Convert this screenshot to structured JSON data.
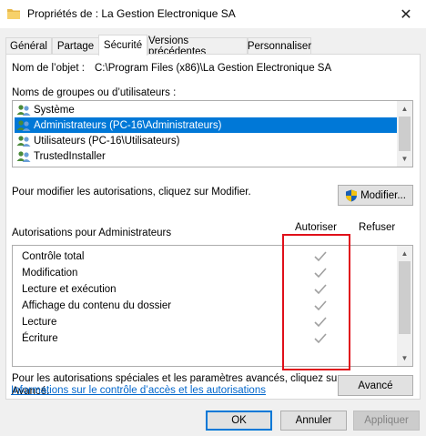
{
  "window": {
    "title": "Propriétés de : La Gestion Electronique SA",
    "close_glyph": "✕"
  },
  "tabs": [
    {
      "label": "Général"
    },
    {
      "label": "Partage"
    },
    {
      "label": "Sécurité"
    },
    {
      "label": "Versions précédentes"
    },
    {
      "label": "Personnaliser"
    }
  ],
  "security": {
    "object_name_label": "Nom de l’objet :",
    "object_name_value": "C:\\Program Files (x86)\\La Gestion Electronique SA",
    "groups_label": "Noms de groupes ou d’utilisateurs :",
    "groups": [
      {
        "label": "Système",
        "icon": "user-group-icon"
      },
      {
        "label": "Administrateurs (PC-16\\Administrateurs)",
        "icon": "user-group-icon",
        "selected": true
      },
      {
        "label": "Utilisateurs (PC-16\\Utilisateurs)",
        "icon": "user-group-icon"
      },
      {
        "label": "TrustedInstaller",
        "icon": "user-group-icon"
      }
    ],
    "modify_hint": "Pour modifier les autorisations, cliquez sur Modifier.",
    "modify_button": "Modifier...",
    "permissions_label": "Autorisations pour Administrateurs",
    "allow_header": "Autoriser",
    "deny_header": "Refuser",
    "permissions": [
      {
        "name": "Contrôle total",
        "allow": true,
        "deny": false
      },
      {
        "name": "Modification",
        "allow": true,
        "deny": false
      },
      {
        "name": "Lecture et exécution",
        "allow": true,
        "deny": false
      },
      {
        "name": "Affichage du contenu du dossier",
        "allow": true,
        "deny": false
      },
      {
        "name": "Lecture",
        "allow": true,
        "deny": false
      },
      {
        "name": "Écriture",
        "allow": true,
        "deny": false
      }
    ],
    "special_hint_line1": "Pour les autorisations spéciales et les paramètres avancés, cliquez sur",
    "special_hint_line2": "Avancé.",
    "advanced_button": "Avancé",
    "info_link": "Informations sur le contrôle d’accès et les autorisations"
  },
  "footer": {
    "ok": "OK",
    "cancel": "Annuler",
    "apply": "Appliquer"
  },
  "colors": {
    "selection": "#0078d7",
    "highlight_box": "#e0101a",
    "link": "#0066cc"
  }
}
